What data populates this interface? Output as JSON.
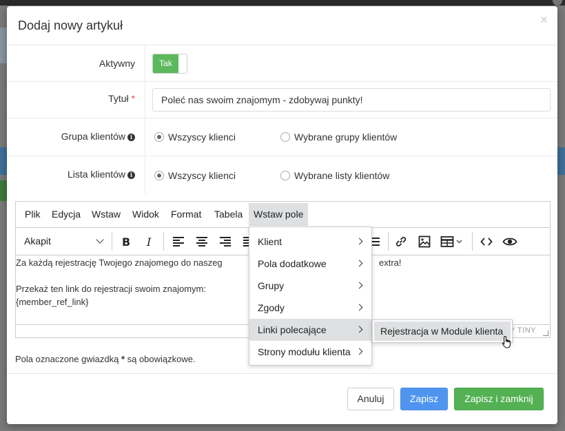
{
  "modal": {
    "title": "Dodaj nowy artykuł",
    "close_label": "×"
  },
  "form": {
    "active": {
      "label": "Aktywny",
      "toggle_on_label": "Tak",
      "value": true
    },
    "title": {
      "label": "Tytuł",
      "required_mark": "*",
      "value": "Poleć nas swoim znajomym - zdobywaj punkty!"
    },
    "client_group": {
      "label": "Grupa klientów",
      "options": [
        "Wszyscy klienci",
        "Wybrane grupy klientów"
      ],
      "selected": "Wszyscy klienci"
    },
    "client_list": {
      "label": "Lista klientów",
      "options": [
        "Wszyscy klienci",
        "Wybrane listy klientów"
      ],
      "selected": "Wszyscy klienci"
    }
  },
  "editor": {
    "menubar": [
      "Plik",
      "Edycja",
      "Wstaw",
      "Widok",
      "Format",
      "Tabela",
      "Wstaw pole"
    ],
    "active_menu": "Wstaw pole",
    "block_format": "Akapit",
    "toolbar_icons": [
      "bold-icon",
      "italic-icon",
      "align-left-icon",
      "align-center-icon",
      "align-right-icon",
      "align-justify-icon",
      "numbered-list-icon",
      "link-icon",
      "image-icon",
      "table-icon",
      "code-icon",
      "preview-icon"
    ],
    "content": {
      "line1_start": "Za każdą rejestrację Twojego znajomego do naszeg",
      "line1_end": "extra!",
      "line2": "Przekaż ten link do rejestracji swoim znajomym:",
      "line3": "{member_ref_link}"
    },
    "status_brand": "Y TINY"
  },
  "insert_field_menu": {
    "items": [
      "Klient",
      "Pola dodatkowe",
      "Grupy",
      "Zgody",
      "Linki polecające",
      "Strony modułu klienta"
    ],
    "hovered": "Linki polecające",
    "submenu": [
      "Rejestracja w Module klienta"
    ]
  },
  "required_note": {
    "before": "Pola oznaczone gwiazdką ",
    "star": "*",
    "after": " są obowiązkowe."
  },
  "footer": {
    "cancel_label": "Anuluj",
    "save_label": "Zapisz",
    "save_close_label": "Zapisz i zamknij"
  },
  "colors": {
    "success": "#53b153",
    "primary": "#4f95ef",
    "required": "#d9534f",
    "menu_hover": "#dee0e2"
  }
}
